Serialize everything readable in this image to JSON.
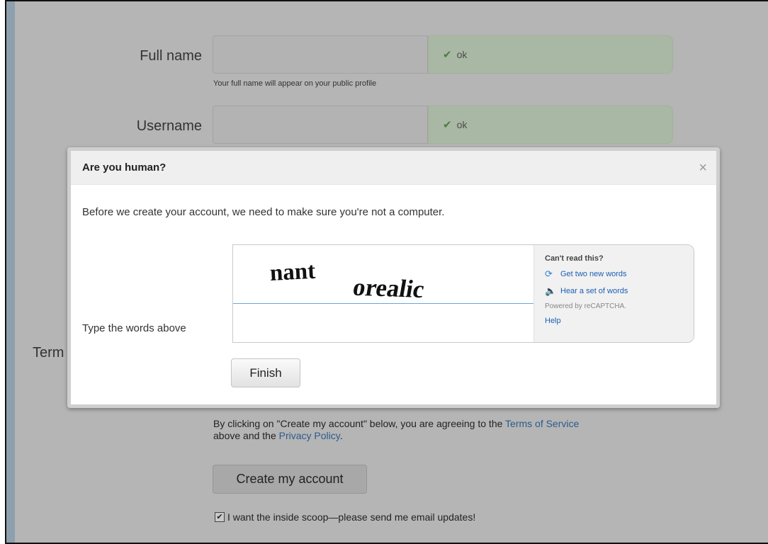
{
  "form": {
    "full_name_label": "Full name",
    "full_name_ok": "ok",
    "full_name_help": "Your full name will appear on your public profile",
    "username_label": "Username",
    "username_ok": "ok",
    "terms_label_partial": "Term",
    "agreement": {
      "prefix": "By clicking on \"Create my account\" below, you are agreeing to the ",
      "terms_link": "Terms of Service",
      "middle": " above and the ",
      "privacy_link": "Privacy Policy",
      "suffix": "."
    },
    "create_button": "Create my account",
    "email_updates_label": "I want the inside scoop—please send me email updates!",
    "email_updates_checked": true
  },
  "modal": {
    "title": "Are you human?",
    "close_glyph": "×",
    "intro": "Before we create your account, we need to make sure you're not a computer.",
    "type_label": "Type the words above",
    "finish_button": "Finish",
    "captcha": {
      "word1": "nant",
      "word2": "orealic",
      "input_value": "",
      "cant_read": "Can't read this?",
      "new_words_link": "Get two new words",
      "audio_link": "Hear a set of words",
      "powered_by": "Powered by reCAPTCHA.",
      "help_link": "Help"
    }
  },
  "icons": {
    "ok_check": "checkmark-icon",
    "refresh": "refresh-icon",
    "audio": "speaker-icon",
    "close": "close-icon"
  },
  "colors": {
    "overlay": "#b5b5b5",
    "ok_background": "#a9b8a4",
    "link": "#1a5fb4",
    "input_focus_border": "#6aa7db"
  }
}
